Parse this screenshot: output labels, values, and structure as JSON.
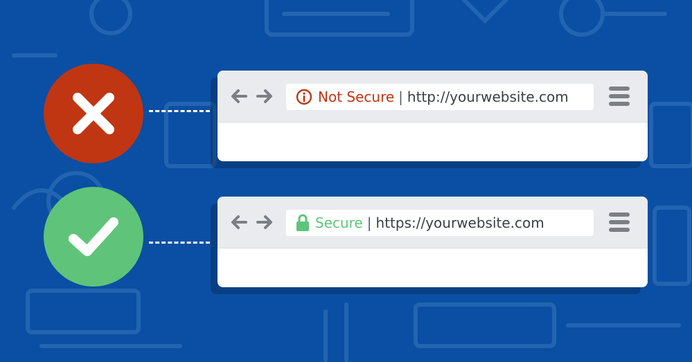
{
  "colors": {
    "background": "#0a4fa3",
    "insecure": "#c03612",
    "secure": "#5fc47a",
    "toolbar": "#e9ebee",
    "icon_gray": "#7b7f85"
  },
  "insecure_example": {
    "status_icon": "info-circle-icon",
    "status_label": "Not Secure",
    "separator": "|",
    "url": "http://yourwebsite.com",
    "badge_icon": "x-mark-icon"
  },
  "secure_example": {
    "status_icon": "padlock-icon",
    "status_label": "Secure",
    "separator": "|",
    "url": "https://yourwebsite.com",
    "badge_icon": "checkmark-icon"
  }
}
